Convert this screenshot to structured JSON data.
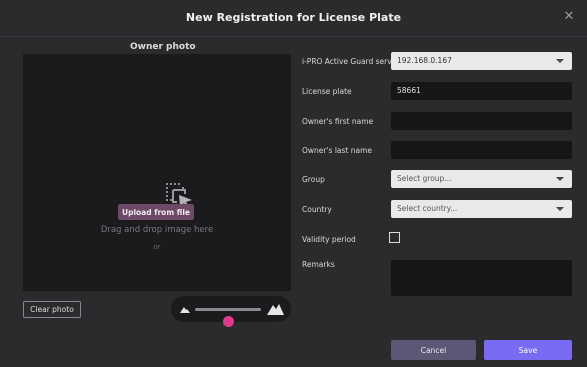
{
  "dialog": {
    "title": "New Registration for License Plate"
  },
  "photo": {
    "section_title": "Owner photo",
    "drag_text": "Drag and drop image here",
    "or_text": "or",
    "upload_label": "Upload from file",
    "clear_label": "Clear photo",
    "zoom_level": 0.5
  },
  "form": {
    "server_label": "i-PRO Active Guard server",
    "server_value": "192.168.0.167",
    "plate_label": "License plate",
    "plate_value": "58661",
    "first_name_label": "Owner's first name",
    "first_name_value": "",
    "last_name_label": "Owner's last name",
    "last_name_value": "",
    "group_label": "Group",
    "group_value": "Select group...",
    "country_label": "Country",
    "country_value": "Select country...",
    "validity_label": "Validity period",
    "validity_checked": false,
    "remarks_label": "Remarks",
    "remarks_value": ""
  },
  "actions": {
    "cancel_label": "Cancel",
    "save_label": "Save"
  },
  "colors": {
    "accent": "#7a6cf2",
    "upload": "#6c4a68",
    "slider_thumb": "#e03a8c"
  },
  "icons": [
    "close-icon",
    "image-select-icon",
    "mountain-small-icon",
    "mountain-large-icon",
    "chevron-down-icon"
  ]
}
